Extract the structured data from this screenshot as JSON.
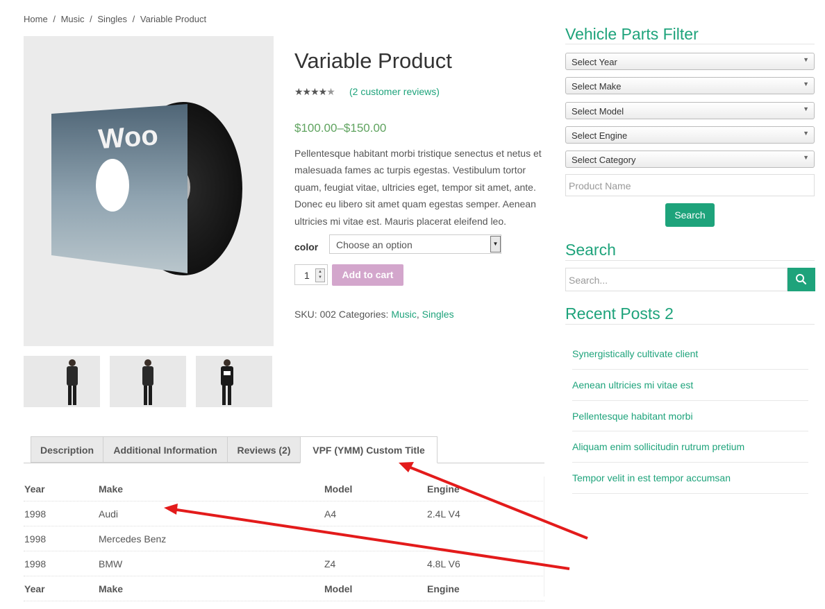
{
  "breadcrumb": {
    "home": "Home",
    "music": "Music",
    "singles": "Singles",
    "current": "Variable Product",
    "sep": "/"
  },
  "product": {
    "title": "Variable Product",
    "rating": 4.5,
    "reviews_link": "(2 customer reviews)",
    "price": "$100.00–$150.00",
    "description": "Pellentesque habitant morbi tristique senectus et netus et malesuada fames ac turpis egestas. Vestibulum tortor quam, feugiat vitae, ultricies eget, tempor sit amet, ante. Donec eu libero sit amet quam egestas semper. Aenean ultricies mi vitae est. Mauris placerat eleifend leo.",
    "color_label": "color",
    "color_placeholder": "Choose an option",
    "quantity": "1",
    "add_to_cart": "Add to cart",
    "sku_label": "SKU:",
    "sku": "002",
    "categories_label": "Categories:",
    "categories": [
      "Music",
      "Singles"
    ],
    "image_text": "Woo"
  },
  "tabs": [
    {
      "label": "Description"
    },
    {
      "label": "Additional Information"
    },
    {
      "label": "Reviews (2)"
    },
    {
      "label": "VPF (YMM) Custom Title"
    }
  ],
  "fitment_table": {
    "headers": [
      "Year",
      "Make",
      "Model",
      "Engine"
    ],
    "rows": [
      [
        "1998",
        "Audi",
        "A4",
        "2.4L V4"
      ],
      [
        "1998",
        "Mercedes Benz",
        "",
        ""
      ],
      [
        "1998",
        "BMW",
        "Z4",
        "4.8L V6"
      ]
    ]
  },
  "sidebar": {
    "vpf_title": "Vehicle Parts Filter",
    "selects": [
      "Select Year",
      "Select Make",
      "Select Model",
      "Select Engine",
      "Select Category"
    ],
    "product_name_placeholder": "Product Name",
    "search_button": "Search",
    "search_title": "Search",
    "search_placeholder": "Search...",
    "recent_title": "Recent Posts 2",
    "recent_posts": [
      "Synergistically cultivate client",
      "Aenean ultricies mi vitae est",
      "Pellentesque habitant morbi",
      "Aliquam enim sollicitudin rutrum pretium",
      "Tempor velit in est tempor accumsan"
    ]
  },
  "colors": {
    "accent": "#1ea37b",
    "price": "#5fa35f",
    "cart_button": "#d3a6cc",
    "annotation_arrow": "#e31b1b"
  }
}
